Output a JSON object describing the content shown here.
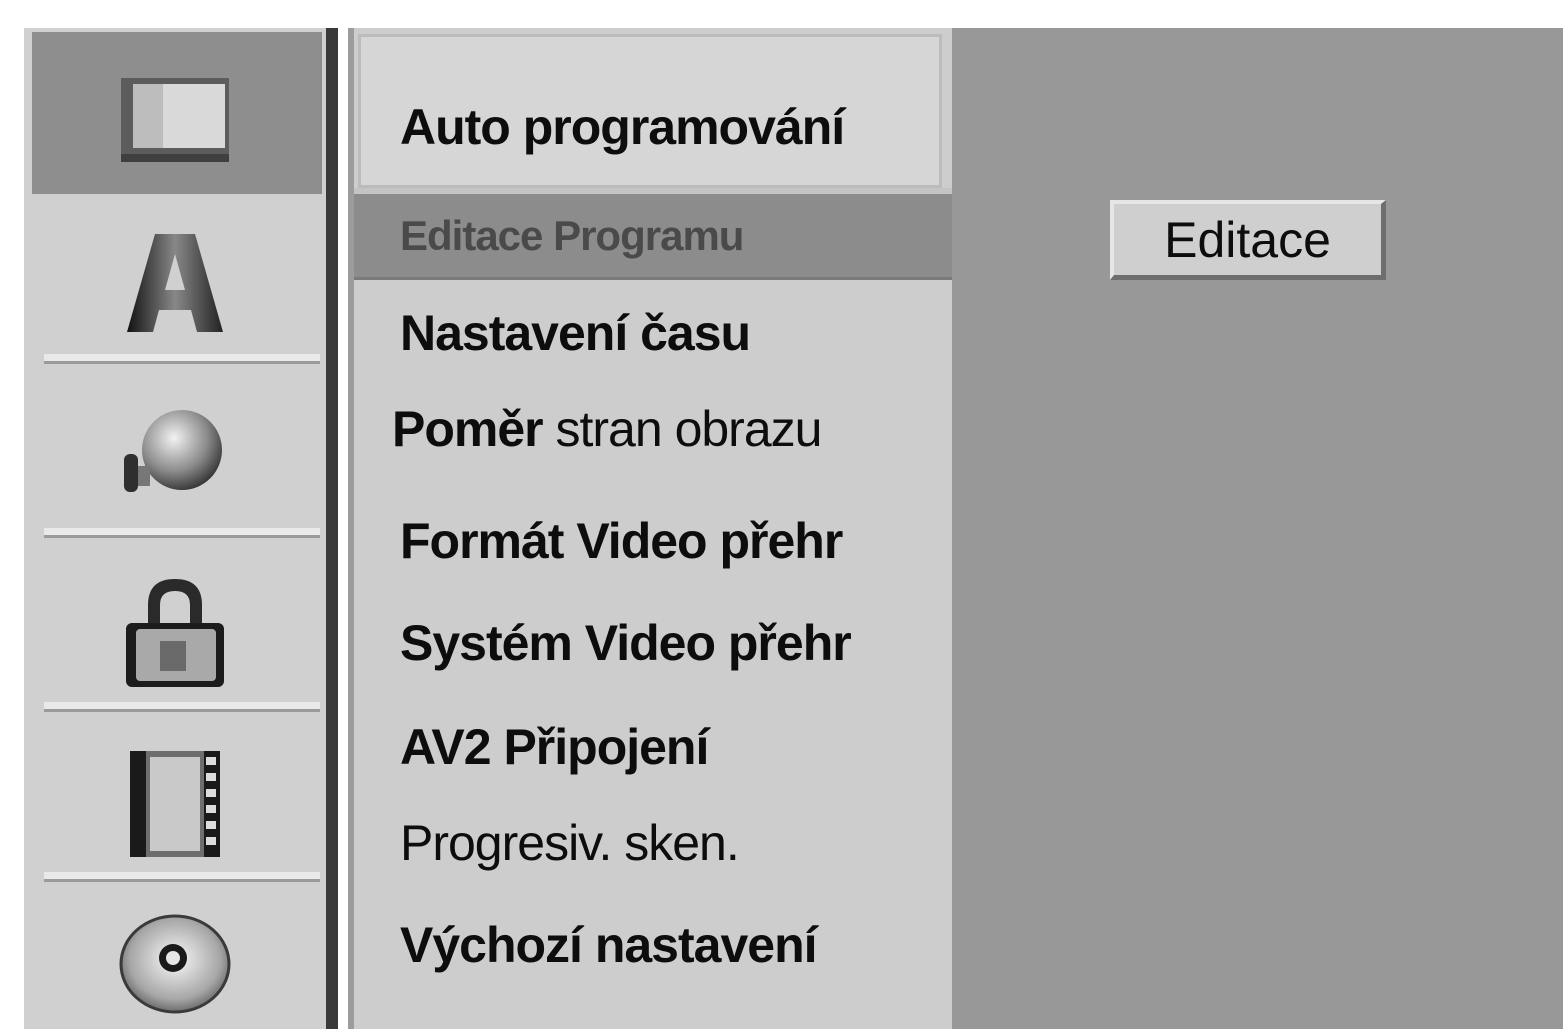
{
  "sidebar": {
    "icons": [
      {
        "name": "tv-screen-icon",
        "selected": true
      },
      {
        "name": "letter-a-icon",
        "selected": false
      },
      {
        "name": "audio-note-icon",
        "selected": false
      },
      {
        "name": "lock-icon",
        "selected": false
      },
      {
        "name": "film-strip-icon",
        "selected": false
      },
      {
        "name": "disc-icon",
        "selected": false
      }
    ]
  },
  "menu": {
    "items": [
      {
        "label": "Auto programování"
      },
      {
        "label": "Editace Programu"
      },
      {
        "label": "Nastavení času"
      },
      {
        "label_bold": "Poměr",
        "label_rest": " stran obrazu"
      },
      {
        "label": "Formát Video přehr"
      },
      {
        "label": "Systém Video přehr"
      },
      {
        "label": "AV2 Připojení"
      },
      {
        "label": "Progresiv. sken."
      },
      {
        "label": "Výchozí nastavení"
      }
    ]
  },
  "panel": {
    "option_label": "Editace"
  },
  "colors": {
    "panel_bg": "#989898",
    "menu_bg": "#cdcdcd",
    "selected_bg": "#8c8c8c"
  }
}
